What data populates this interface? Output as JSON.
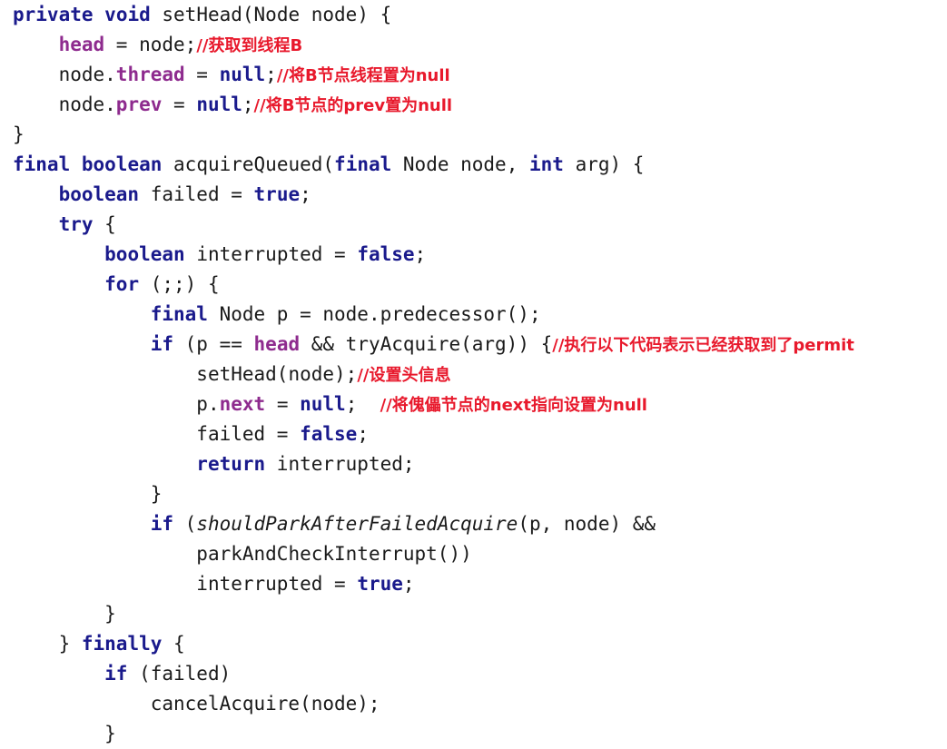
{
  "document": {
    "type": "source-code-screenshot",
    "language": "Java",
    "title": "AbstractQueuedSynchronizer setHead / acquireQueued",
    "colors": {
      "background": "#ffffff",
      "keyword": "#1a1a8c",
      "field": "#8e2b8e",
      "comment": "#e8192c",
      "plain": "#1a1a1a"
    }
  },
  "code": {
    "lines": [
      {
        "id": "line-1",
        "indent": 0,
        "tokens": [
          {
            "t": "private",
            "c": "kw"
          },
          {
            "t": " ",
            "c": "plain"
          },
          {
            "t": "void",
            "c": "kw"
          },
          {
            "t": " setHead(Node node) {",
            "c": "plain"
          }
        ]
      },
      {
        "id": "line-2",
        "indent": 1,
        "tokens": [
          {
            "t": "head",
            "c": "fld"
          },
          {
            "t": " = node;",
            "c": "plain"
          },
          {
            "t": "//获取到线程B",
            "c": "cmt"
          }
        ]
      },
      {
        "id": "line-3",
        "indent": 1,
        "tokens": [
          {
            "t": "node.",
            "c": "plain"
          },
          {
            "t": "thread",
            "c": "fld"
          },
          {
            "t": " = ",
            "c": "plain"
          },
          {
            "t": "null",
            "c": "kw"
          },
          {
            "t": ";",
            "c": "plain"
          },
          {
            "t": "//将B节点线程置为null",
            "c": "cmt"
          }
        ]
      },
      {
        "id": "line-4",
        "indent": 1,
        "tokens": [
          {
            "t": "node.",
            "c": "plain"
          },
          {
            "t": "prev",
            "c": "fld"
          },
          {
            "t": " = ",
            "c": "plain"
          },
          {
            "t": "null",
            "c": "kw"
          },
          {
            "t": ";",
            "c": "plain"
          },
          {
            "t": "//将B节点的prev置为null",
            "c": "cmt"
          }
        ]
      },
      {
        "id": "line-5",
        "indent": 0,
        "tokens": [
          {
            "t": "}",
            "c": "plain"
          }
        ]
      },
      {
        "id": "line-6",
        "indent": 0,
        "tokens": [
          {
            "t": "final",
            "c": "kw"
          },
          {
            "t": " ",
            "c": "plain"
          },
          {
            "t": "boolean",
            "c": "kw"
          },
          {
            "t": " acquireQueued(",
            "c": "plain"
          },
          {
            "t": "final",
            "c": "kw"
          },
          {
            "t": " Node node, ",
            "c": "plain"
          },
          {
            "t": "int",
            "c": "kw"
          },
          {
            "t": " arg) {",
            "c": "plain"
          }
        ]
      },
      {
        "id": "line-7",
        "indent": 1,
        "tokens": [
          {
            "t": "boolean",
            "c": "kw"
          },
          {
            "t": " failed = ",
            "c": "plain"
          },
          {
            "t": "true",
            "c": "kw"
          },
          {
            "t": ";",
            "c": "plain"
          }
        ]
      },
      {
        "id": "line-8",
        "indent": 1,
        "tokens": [
          {
            "t": "try",
            "c": "kw"
          },
          {
            "t": " {",
            "c": "plain"
          }
        ]
      },
      {
        "id": "line-9",
        "indent": 2,
        "tokens": [
          {
            "t": "boolean",
            "c": "kw"
          },
          {
            "t": " interrupted = ",
            "c": "plain"
          },
          {
            "t": "false",
            "c": "kw"
          },
          {
            "t": ";",
            "c": "plain"
          }
        ]
      },
      {
        "id": "line-10",
        "indent": 2,
        "tokens": [
          {
            "t": "for",
            "c": "kw"
          },
          {
            "t": " (;;) {",
            "c": "plain"
          }
        ]
      },
      {
        "id": "line-11",
        "indent": 3,
        "tokens": [
          {
            "t": "final",
            "c": "kw"
          },
          {
            "t": " Node p = node.predecessor();",
            "c": "plain"
          }
        ]
      },
      {
        "id": "line-12",
        "indent": 3,
        "tokens": [
          {
            "t": "if",
            "c": "kw"
          },
          {
            "t": " (p == ",
            "c": "plain"
          },
          {
            "t": "head",
            "c": "fld"
          },
          {
            "t": " && tryAcquire(arg)) {",
            "c": "plain"
          },
          {
            "t": "//执行以下代码表示已经获取到了permit",
            "c": "cmt"
          }
        ]
      },
      {
        "id": "line-13",
        "indent": 4,
        "tokens": [
          {
            "t": "setHead(node);",
            "c": "plain"
          },
          {
            "t": "//设置头信息",
            "c": "cmt"
          }
        ]
      },
      {
        "id": "line-14",
        "indent": 4,
        "tokens": [
          {
            "t": "p.",
            "c": "plain"
          },
          {
            "t": "next",
            "c": "fld"
          },
          {
            "t": " = ",
            "c": "plain"
          },
          {
            "t": "null",
            "c": "kw"
          },
          {
            "t": ";  ",
            "c": "plain"
          },
          {
            "t": "//将傀儡节点的next指向设置为null",
            "c": "cmt"
          }
        ]
      },
      {
        "id": "line-15",
        "indent": 4,
        "tokens": [
          {
            "t": "failed = ",
            "c": "plain"
          },
          {
            "t": "false",
            "c": "kw"
          },
          {
            "t": ";",
            "c": "plain"
          }
        ]
      },
      {
        "id": "line-16",
        "indent": 4,
        "tokens": [
          {
            "t": "return",
            "c": "kw"
          },
          {
            "t": " interrupted;",
            "c": "plain"
          }
        ]
      },
      {
        "id": "line-17",
        "indent": 3,
        "tokens": [
          {
            "t": "}",
            "c": "plain"
          }
        ]
      },
      {
        "id": "line-18",
        "indent": 3,
        "tokens": [
          {
            "t": "if",
            "c": "kw"
          },
          {
            "t": " (",
            "c": "plain"
          },
          {
            "t": "shouldParkAfterFailedAcquire",
            "c": "ital"
          },
          {
            "t": "(p, node) &&",
            "c": "plain"
          }
        ]
      },
      {
        "id": "line-19",
        "indent": 4,
        "tokens": [
          {
            "t": "parkAndCheckInterrupt())",
            "c": "plain"
          }
        ]
      },
      {
        "id": "line-20",
        "indent": 4,
        "tokens": [
          {
            "t": "interrupted = ",
            "c": "plain"
          },
          {
            "t": "true",
            "c": "kw"
          },
          {
            "t": ";",
            "c": "plain"
          }
        ]
      },
      {
        "id": "line-21",
        "indent": 2,
        "tokens": [
          {
            "t": "}",
            "c": "plain"
          }
        ]
      },
      {
        "id": "line-22",
        "indent": 1,
        "tokens": [
          {
            "t": "} ",
            "c": "plain"
          },
          {
            "t": "finally",
            "c": "kw"
          },
          {
            "t": " {",
            "c": "plain"
          }
        ]
      },
      {
        "id": "line-23",
        "indent": 2,
        "tokens": [
          {
            "t": "if",
            "c": "kw"
          },
          {
            "t": " (failed)",
            "c": "plain"
          }
        ]
      },
      {
        "id": "line-24",
        "indent": 3,
        "tokens": [
          {
            "t": "cancelAcquire(node);",
            "c": "plain"
          }
        ]
      },
      {
        "id": "line-25",
        "indent": 2,
        "tokens": [
          {
            "t": "}",
            "c": "plain"
          }
        ]
      }
    ]
  }
}
